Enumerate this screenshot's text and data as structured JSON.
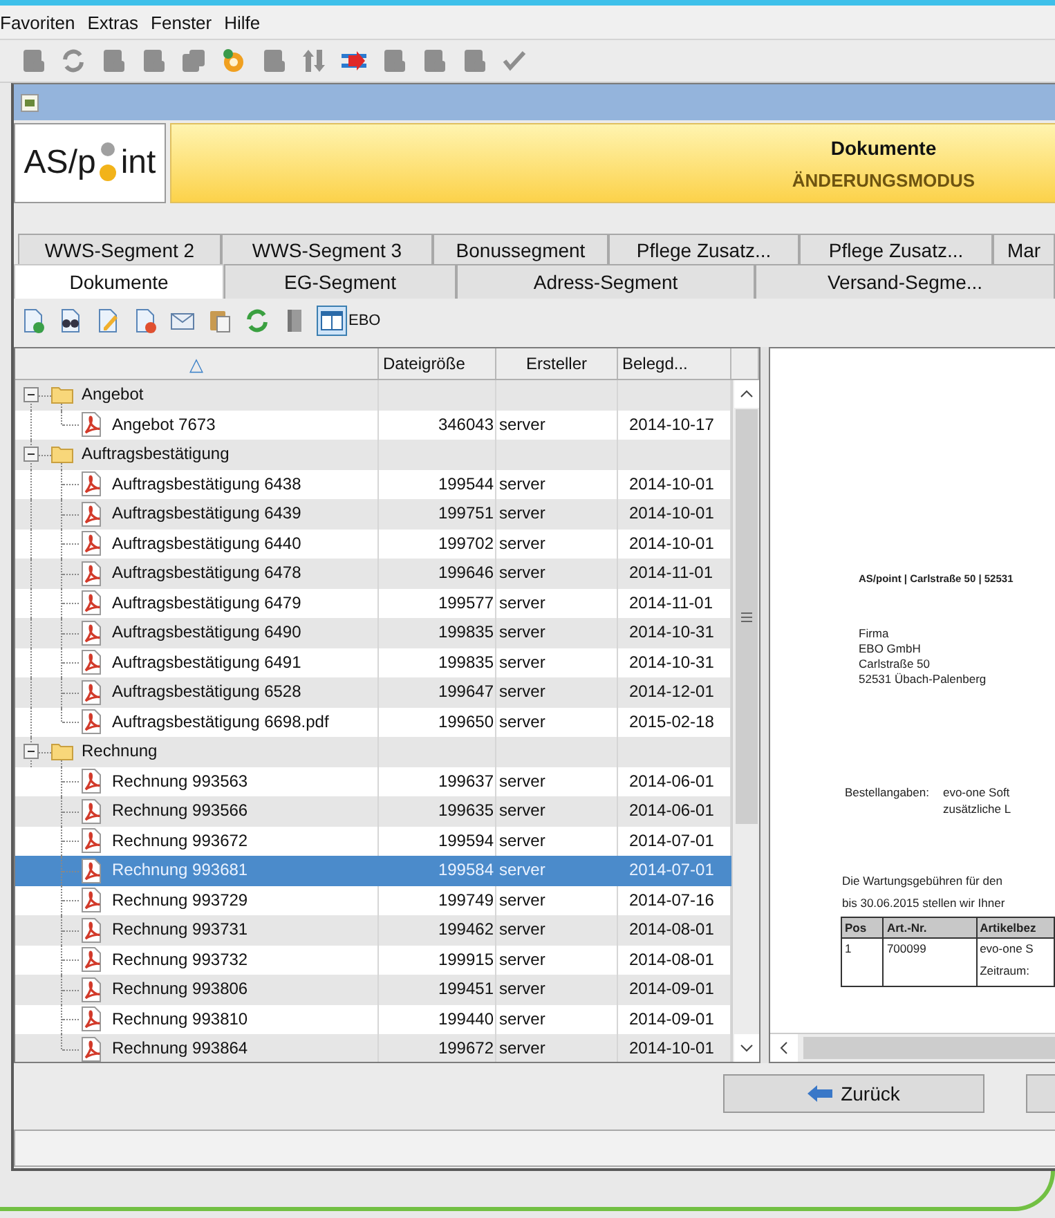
{
  "menu": [
    {
      "label": "Favoriten"
    },
    {
      "label": "Extras"
    },
    {
      "label": "Fenster"
    },
    {
      "label": "Hilfe"
    }
  ],
  "toolbar": [
    {
      "disabled": true
    },
    {
      "disabled": true
    },
    {
      "disabled": true
    },
    {
      "disabled": true
    },
    {
      "disabled": true
    },
    {
      "disabled": false
    },
    {
      "disabled": true
    },
    {
      "disabled": true
    },
    {
      "disabled": false
    },
    {
      "disabled": true
    },
    {
      "disabled": true
    },
    {
      "disabled": true
    },
    {
      "disabled": true
    }
  ],
  "header": {
    "logo_left": "AS/p",
    "logo_right": "int",
    "title": "Dokumente",
    "mode": "ÄNDERUNGSMODUS"
  },
  "tab_rows": [
    {
      "tabs": [
        {
          "label": "WWS-Segment 2",
          "selected": false
        },
        {
          "label": "WWS-Segment 3",
          "selected": false
        },
        {
          "label": "Bonussegment",
          "selected": false
        },
        {
          "label": "Pflege Zusatz...",
          "selected": false
        },
        {
          "label": "Pflege Zusatz...",
          "selected": false
        },
        {
          "label": "Mar",
          "selected": false
        }
      ]
    },
    {
      "tabs": [
        {
          "label": "Dokumente",
          "selected": true
        },
        {
          "label": "EG-Segment",
          "selected": false
        },
        {
          "label": "Adress-Segment",
          "selected": false
        },
        {
          "label": "Versand-Segme...",
          "selected": false
        }
      ]
    }
  ],
  "doc_toolbar": {
    "buttons": [
      {
        "pressed": false
      },
      {
        "pressed": false
      },
      {
        "pressed": false
      },
      {
        "pressed": false
      },
      {
        "pressed": false
      },
      {
        "pressed": false
      },
      {
        "pressed": false
      },
      {
        "pressed": false
      },
      {
        "pressed": true
      }
    ],
    "label": "EBO"
  },
  "tree": {
    "columns": [
      {
        "label": "△"
      },
      {
        "label": "Dateigröße"
      },
      {
        "label": "Ersteller"
      },
      {
        "label": "Belegd..."
      }
    ],
    "groups": [
      {
        "name": "Angebot",
        "expanded": true,
        "selected": false,
        "children": [
          {
            "name": "Angebot 7673",
            "size": "346043",
            "creator": "server",
            "date": "2014-10-17",
            "selected": false
          }
        ]
      },
      {
        "name": "Auftragsbestätigung",
        "expanded": true,
        "selected": false,
        "children": [
          {
            "name": "Auftragsbestätigung 6438",
            "size": "199544",
            "creator": "server",
            "date": "2014-10-01",
            "selected": false
          },
          {
            "name": "Auftragsbestätigung 6439",
            "size": "199751",
            "creator": "server",
            "date": "2014-10-01",
            "selected": false
          },
          {
            "name": "Auftragsbestätigung 6440",
            "size": "199702",
            "creator": "server",
            "date": "2014-10-01",
            "selected": false
          },
          {
            "name": "Auftragsbestätigung 6478",
            "size": "199646",
            "creator": "server",
            "date": "2014-11-01",
            "selected": false
          },
          {
            "name": "Auftragsbestätigung 6479",
            "size": "199577",
            "creator": "server",
            "date": "2014-11-01",
            "selected": false
          },
          {
            "name": "Auftragsbestätigung 6490",
            "size": "199835",
            "creator": "server",
            "date": "2014-10-31",
            "selected": false
          },
          {
            "name": "Auftragsbestätigung 6491",
            "size": "199835",
            "creator": "server",
            "date": "2014-10-31",
            "selected": false
          },
          {
            "name": "Auftragsbestätigung 6528",
            "size": "199647",
            "creator": "server",
            "date": "2014-12-01",
            "selected": false
          },
          {
            "name": "Auftragsbestätigung 6698.pdf",
            "size": "199650",
            "creator": "server",
            "date": "2015-02-18",
            "selected": false
          }
        ]
      },
      {
        "name": "Rechnung",
        "expanded": true,
        "selected": false,
        "children": [
          {
            "name": "Rechnung 993563",
            "size": "199637",
            "creator": "server",
            "date": "2014-06-01",
            "selected": false
          },
          {
            "name": "Rechnung 993566",
            "size": "199635",
            "creator": "server",
            "date": "2014-06-01",
            "selected": false
          },
          {
            "name": "Rechnung 993672",
            "size": "199594",
            "creator": "server",
            "date": "2014-07-01",
            "selected": false
          },
          {
            "name": "Rechnung 993681",
            "size": "199584",
            "creator": "server",
            "date": "2014-07-01",
            "selected": true
          },
          {
            "name": "Rechnung 993729",
            "size": "199749",
            "creator": "server",
            "date": "2014-07-16",
            "selected": false
          },
          {
            "name": "Rechnung 993731",
            "size": "199462",
            "creator": "server",
            "date": "2014-08-01",
            "selected": false
          },
          {
            "name": "Rechnung 993732",
            "size": "199915",
            "creator": "server",
            "date": "2014-08-01",
            "selected": false
          },
          {
            "name": "Rechnung 993806",
            "size": "199451",
            "creator": "server",
            "date": "2014-09-01",
            "selected": false
          },
          {
            "name": "Rechnung 993810",
            "size": "199440",
            "creator": "server",
            "date": "2014-09-01",
            "selected": false
          },
          {
            "name": "Rechnung 993864",
            "size": "199672",
            "creator": "server",
            "date": "2014-10-01",
            "selected": false
          }
        ]
      }
    ]
  },
  "preview": {
    "sender_line": "AS/point | Carlstraße 50 | 52531",
    "address": [
      "Firma",
      "EBO GmbH",
      "Carlstraße 50",
      "52531 Übach-Palenberg"
    ],
    "order_label": "Bestellangaben:",
    "order_lines": [
      "evo-one Soft",
      "zusätzliche L"
    ],
    "intro": [
      "Die Wartungsgebühren für den",
      "bis 30.06.2015 stellen wir Ihner"
    ],
    "table": {
      "columns": [
        "Pos",
        "Art.-Nr.",
        "Artikelbez"
      ],
      "rows": [
        {
          "cells": [
            "1",
            "700099",
            "evo-one S"
          ],
          "note": "Zeitraum:"
        }
      ]
    }
  },
  "buttons": [
    {
      "kind": "back",
      "label": "Zurück"
    },
    {
      "kind": "blank"
    }
  ]
}
